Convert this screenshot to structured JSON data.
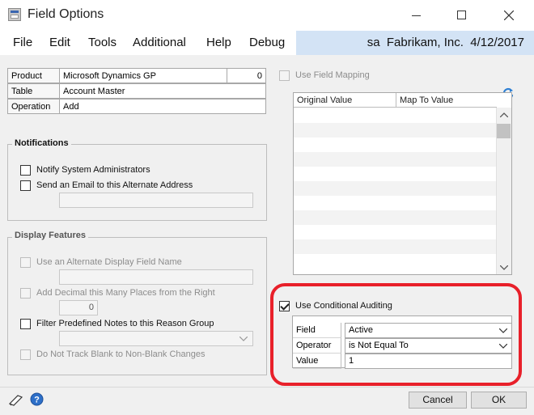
{
  "window": {
    "title": "Field Options"
  },
  "menu": {
    "items": [
      "File",
      "Edit",
      "Tools",
      "Additional",
      "Help",
      "Debug"
    ],
    "user": "sa",
    "company": "Fabrikam, Inc.",
    "date": "4/12/2017"
  },
  "info": {
    "product_label": "Product",
    "product_value": "Microsoft Dynamics GP",
    "product_id": "0",
    "table_label": "Table",
    "table_value": "Account Master",
    "operation_label": "Operation",
    "operation_value": "Add"
  },
  "notifications": {
    "title": "Notifications",
    "notify_admins": "Notify System Administrators",
    "send_email": "Send an Email to this Alternate Address",
    "email_value": ""
  },
  "display": {
    "title": "Display Features",
    "alt_display": "Use an Alternate Display Field Name",
    "add_decimal": "Add Decimal this Many Places from the Right",
    "decimal_value": "0",
    "filter_notes": "Filter Predefined Notes to this Reason Group",
    "no_track_blank": "Do Not Track Blank to Non-Blank Changes"
  },
  "mapping": {
    "use_field_mapping": "Use Field Mapping",
    "col_original": "Original Value",
    "col_map_to": "Map To Value"
  },
  "conditional": {
    "use_label": "Use Conditional Auditing",
    "checked": true,
    "field_label": "Field",
    "field_value": "Active",
    "operator_label": "Operator",
    "operator_value": "is Not Equal To",
    "value_label": "Value",
    "value_value": "1"
  },
  "footer": {
    "cancel": "Cancel",
    "ok": "OK"
  },
  "colors": {
    "highlight": "#e8202a",
    "menu_accent": "#d3e3f5"
  }
}
